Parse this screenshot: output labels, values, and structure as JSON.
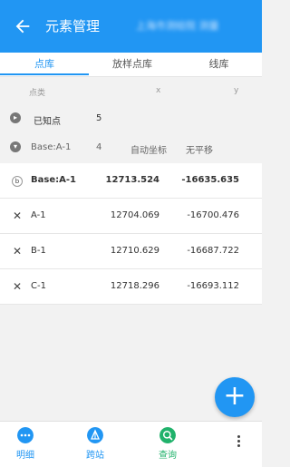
{
  "header": {
    "title": "元素管理",
    "subtitle": "上海市测绘院 测量"
  },
  "tabs": [
    {
      "label": "点库",
      "active": true
    },
    {
      "label": "放样点库",
      "active": false
    },
    {
      "label": "线库",
      "active": false
    }
  ],
  "columns": {
    "name": "点类",
    "x": "x",
    "y": "y"
  },
  "groups": [
    {
      "label": "已知点",
      "count": "5",
      "expanded": false
    },
    {
      "label": "Base:A-1",
      "count": "4",
      "coord_mode": "自动坐标",
      "shift": "无平移",
      "expanded": true
    }
  ],
  "rows": [
    {
      "mark": "base-icon",
      "name": "Base:A-1",
      "x": "12713.524",
      "y": "-16635.635"
    },
    {
      "mark": "cross-icon",
      "name": "A-1",
      "x": "12704.069",
      "y": "-16700.476"
    },
    {
      "mark": "cross-icon",
      "name": "B-1",
      "x": "12710.629",
      "y": "-16687.722"
    },
    {
      "mark": "cross-icon",
      "name": "C-1",
      "x": "12718.296",
      "y": "-16693.112"
    }
  ],
  "fab": {
    "icon": "plus-icon",
    "symbol": "+"
  },
  "bottom_nav": [
    {
      "label": "明细",
      "icon": "detail-icon",
      "color": "#2196f3"
    },
    {
      "label": "跨站",
      "icon": "station-icon",
      "color": "#2196f3"
    },
    {
      "label": "查询",
      "icon": "search-icon",
      "color": "#20b26b"
    }
  ],
  "colors": {
    "accent": "#2196f3",
    "query": "#20b26b"
  }
}
